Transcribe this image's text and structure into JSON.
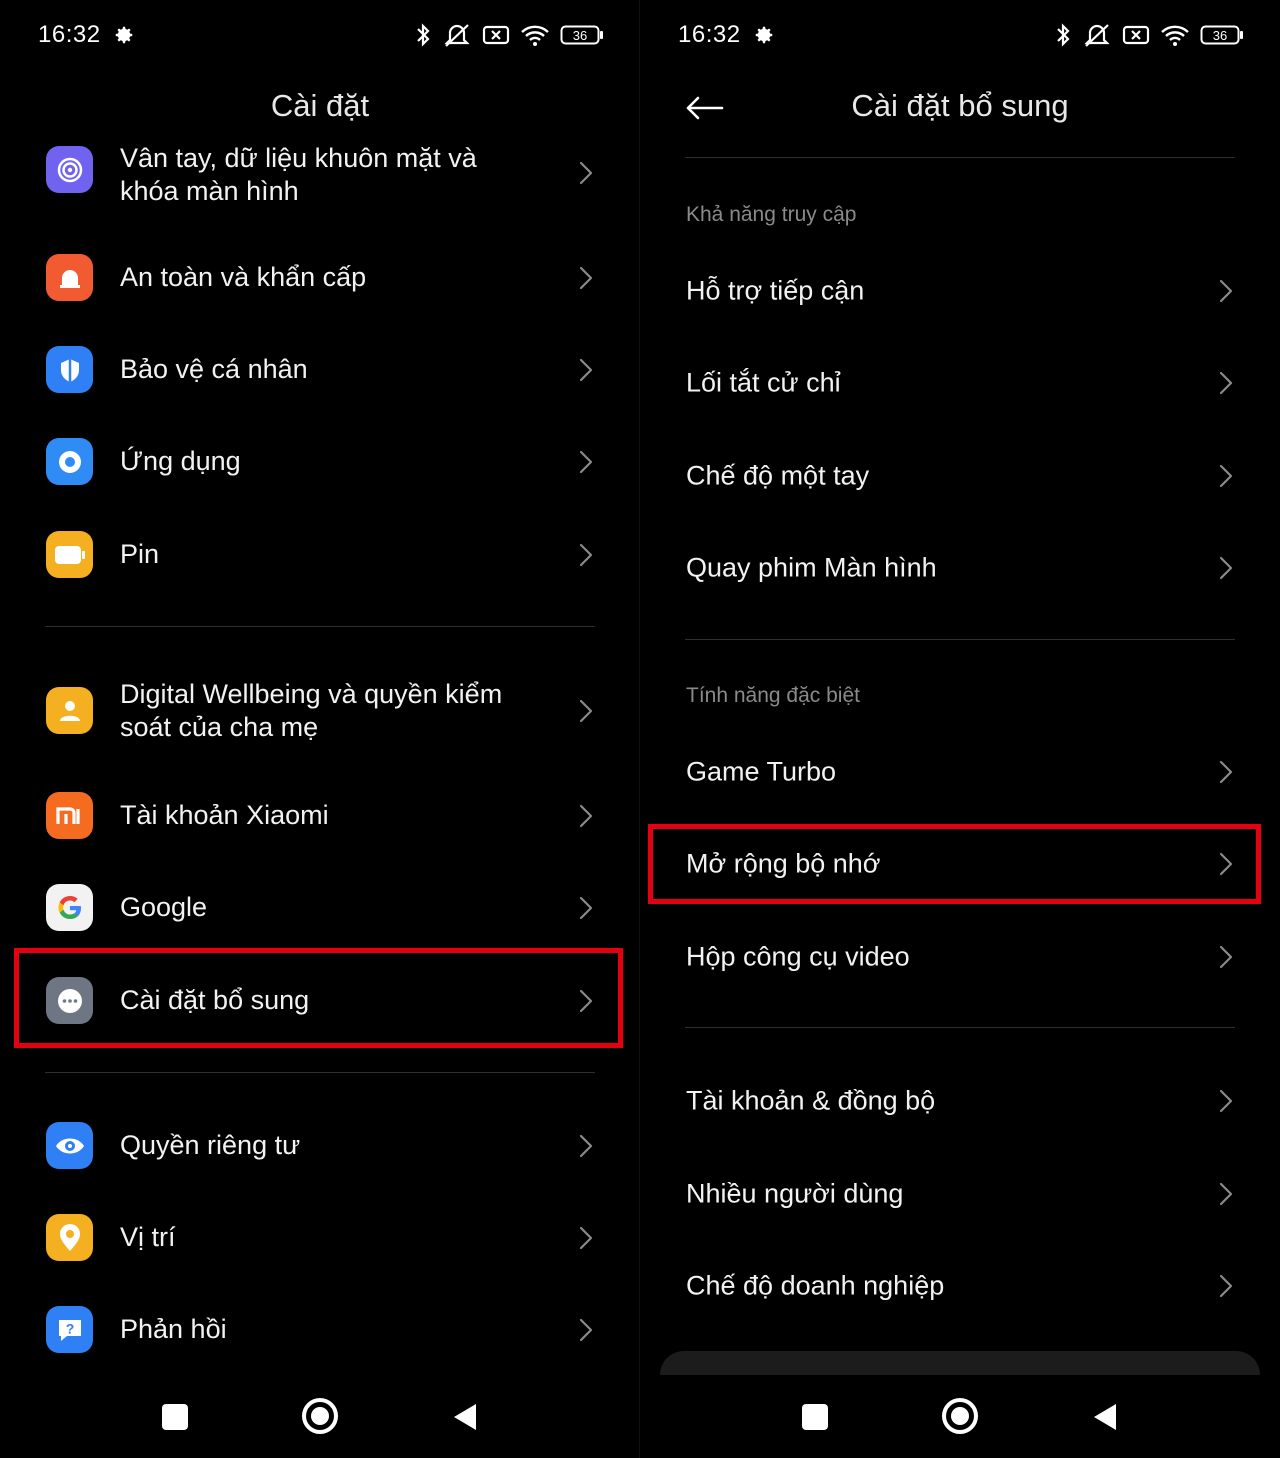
{
  "status_bar": {
    "time": "16:32",
    "battery": "36"
  },
  "left": {
    "title": "Cài đặt",
    "items": [
      {
        "label": "Vân tay, dữ liệu khuôn mặt và khóa màn hình",
        "icon": "fingerprint-icon",
        "color": "#6f63f0"
      },
      {
        "label": "An toàn và khẩn cấp",
        "icon": "emergency-icon",
        "color": "#f25a32"
      },
      {
        "label": "Bảo vệ cá nhân",
        "icon": "shield-icon",
        "color": "#2f7ff5"
      },
      {
        "label": "Ứng dụng",
        "icon": "apps-icon",
        "color": "#2f8cf5"
      },
      {
        "label": "Pin",
        "icon": "battery-icon",
        "color": "#f5b021"
      },
      {
        "label": "Digital Wellbeing và quyền kiểm soát của cha mẹ",
        "icon": "wellbeing-icon",
        "color": "#f5b021"
      },
      {
        "label": "Tài khoản Xiaomi",
        "icon": "xiaomi-icon",
        "color": "#f56b1f"
      },
      {
        "label": "Google",
        "icon": "google-icon",
        "color": "#f2f2f2"
      },
      {
        "label": "Cài đặt bổ sung",
        "icon": "more-icon",
        "color": "#6e7684"
      },
      {
        "label": "Quyền riêng tư",
        "icon": "eye-icon",
        "color": "#2f7ff5"
      },
      {
        "label": "Vị trí",
        "icon": "location-icon",
        "color": "#f5b021"
      },
      {
        "label": "Phản hồi",
        "icon": "feedback-icon",
        "color": "#2f7ff5"
      }
    ],
    "highlight_color": "#e3000f"
  },
  "right": {
    "title": "Cài đặt bổ sung",
    "sections": [
      {
        "header": "Khả năng truy cập",
        "items": [
          "Hỗ trợ tiếp cận",
          "Lối tắt cử chỉ",
          "Chế độ một tay",
          "Quay phim Màn hình"
        ]
      },
      {
        "header": "Tính năng đặc biệt",
        "items": [
          "Game Turbo",
          "Mở rộng bộ nhớ",
          "Hộp công cụ video"
        ]
      },
      {
        "header": "",
        "items": [
          "Tài khoản & đồng bộ",
          "Nhiều người dùng",
          "Chế độ doanh nghiệp"
        ]
      }
    ]
  }
}
